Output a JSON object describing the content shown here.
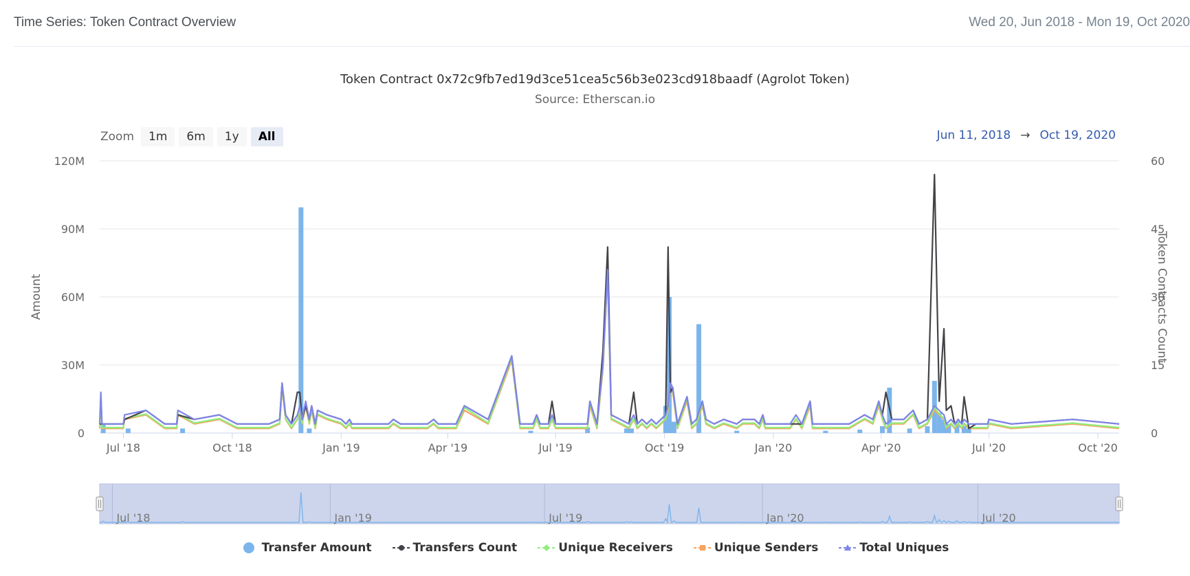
{
  "header": {
    "title": "Time Series: Token Contract Overview",
    "date_range": "Wed 20, Jun 2018 - Mon 19, Oct 2020"
  },
  "zoom": {
    "label": "Zoom",
    "buttons": [
      "1m",
      "6m",
      "1y",
      "All"
    ],
    "active": "All"
  },
  "range": {
    "from": "Jun 11, 2018",
    "arrow": "→",
    "to": "Oct 19, 2020"
  },
  "colors": {
    "transfer_amount": "#7cb5ec",
    "transfers_count": "#434348",
    "unique_receivers": "#90ed7d",
    "unique_senders": "#f7a35c",
    "total_uniques": "#8085e9"
  },
  "chart_data": {
    "type": "bar+line",
    "title": "Token Contract 0x72c9fb7ed19d3ce51cea5c56b3e023cd918baadf (Agrolot Token)",
    "subtitle": "Source: Etherscan.io",
    "ylabel_left": "Amount",
    "ylabel_right": "Token Contracts Count",
    "ylim_left": [
      0,
      120000000
    ],
    "ylim_right": [
      0,
      60
    ],
    "yticks_left": [
      "0",
      "30M",
      "60M",
      "90M",
      "120M"
    ],
    "yticks_right": [
      "0",
      "15",
      "30",
      "45",
      "60"
    ],
    "xlim": [
      "2018-06-11",
      "2020-10-19"
    ],
    "xticks": [
      {
        "date": "2018-07-01",
        "label": "Jul '18"
      },
      {
        "date": "2018-10-01",
        "label": "Oct '18"
      },
      {
        "date": "2019-01-01",
        "label": "Jan '19"
      },
      {
        "date": "2019-04-01",
        "label": "Apr '19"
      },
      {
        "date": "2019-07-01",
        "label": "Jul '19"
      },
      {
        "date": "2019-10-01",
        "label": "Oct '19"
      },
      {
        "date": "2020-01-01",
        "label": "Jan '20"
      },
      {
        "date": "2020-04-01",
        "label": "Apr '20"
      },
      {
        "date": "2020-07-01",
        "label": "Jul '20"
      },
      {
        "date": "2020-10-01",
        "label": "Oct '20"
      }
    ],
    "navigator_ticks": [
      {
        "date": "2018-07-01",
        "label": "Jul '18"
      },
      {
        "date": "2019-01-01",
        "label": "Jan '19"
      },
      {
        "date": "2019-07-01",
        "label": "Jul '19"
      },
      {
        "date": "2020-01-01",
        "label": "Jan '20"
      },
      {
        "date": "2020-07-01",
        "label": "Jul '20"
      }
    ],
    "legend": [
      "Transfer Amount",
      "Transfers Count",
      "Unique Receivers",
      "Unique Senders",
      "Total Uniques"
    ],
    "transfer_amount": {
      "name": "Transfer Amount",
      "axis": "left",
      "points": [
        [
          "2018-06-14",
          4000000
        ],
        [
          "2018-07-05",
          2000000
        ],
        [
          "2018-08-20",
          2000000
        ],
        [
          "2018-11-28",
          99500000
        ],
        [
          "2018-12-05",
          2000000
        ],
        [
          "2019-06-10",
          1000000
        ],
        [
          "2019-07-28",
          2500000
        ],
        [
          "2019-08-30",
          2000000
        ],
        [
          "2019-09-03",
          2000000
        ],
        [
          "2019-10-02",
          12000000
        ],
        [
          "2019-10-05",
          60000000
        ],
        [
          "2019-10-09",
          5000000
        ],
        [
          "2019-10-30",
          48000000
        ],
        [
          "2019-12-01",
          1000000
        ],
        [
          "2020-02-14",
          1000000
        ],
        [
          "2020-03-14",
          1500000
        ],
        [
          "2020-04-02",
          3000000
        ],
        [
          "2020-04-08",
          20000000
        ],
        [
          "2020-04-25",
          2000000
        ],
        [
          "2020-05-10",
          3000000
        ],
        [
          "2020-05-16",
          23000000
        ],
        [
          "2020-05-20",
          9000000
        ],
        [
          "2020-05-24",
          6000000
        ],
        [
          "2020-05-28",
          4000000
        ],
        [
          "2020-06-04",
          5000000
        ],
        [
          "2020-06-10",
          3000000
        ],
        [
          "2020-06-14",
          2000000
        ]
      ]
    },
    "total_uniques": {
      "name": "Total Uniques",
      "axis": "right",
      "points": [
        [
          "2018-06-11",
          2
        ],
        [
          "2018-06-12",
          9
        ],
        [
          "2018-06-13",
          2
        ],
        [
          "2018-07-01",
          2
        ],
        [
          "2018-07-02",
          4
        ],
        [
          "2018-07-20",
          5
        ],
        [
          "2018-08-05",
          2
        ],
        [
          "2018-08-15",
          2
        ],
        [
          "2018-08-16",
          5
        ],
        [
          "2018-08-30",
          3
        ],
        [
          "2018-09-20",
          4
        ],
        [
          "2018-10-05",
          2
        ],
        [
          "2018-11-01",
          2
        ],
        [
          "2018-11-10",
          3
        ],
        [
          "2018-11-12",
          11
        ],
        [
          "2018-11-15",
          4
        ],
        [
          "2018-11-20",
          2
        ],
        [
          "2018-11-25",
          4
        ],
        [
          "2018-11-27",
          6
        ],
        [
          "2018-11-29",
          3
        ],
        [
          "2018-12-02",
          7
        ],
        [
          "2018-12-05",
          3
        ],
        [
          "2018-12-07",
          6
        ],
        [
          "2018-12-10",
          2
        ],
        [
          "2018-12-12",
          5
        ],
        [
          "2018-12-20",
          4
        ],
        [
          "2019-01-01",
          3
        ],
        [
          "2019-01-05",
          2
        ],
        [
          "2019-01-08",
          3
        ],
        [
          "2019-01-10",
          2
        ],
        [
          "2019-02-10",
          2
        ],
        [
          "2019-02-14",
          3
        ],
        [
          "2019-02-20",
          2
        ],
        [
          "2019-03-15",
          2
        ],
        [
          "2019-03-20",
          3
        ],
        [
          "2019-03-24",
          2
        ],
        [
          "2019-04-08",
          2
        ],
        [
          "2019-04-15",
          6
        ],
        [
          "2019-05-05",
          3
        ],
        [
          "2019-05-25",
          17
        ],
        [
          "2019-06-01",
          2
        ],
        [
          "2019-06-12",
          2
        ],
        [
          "2019-06-15",
          4
        ],
        [
          "2019-06-18",
          2
        ],
        [
          "2019-06-25",
          2
        ],
        [
          "2019-06-28",
          4
        ],
        [
          "2019-07-01",
          2
        ],
        [
          "2019-07-20",
          2
        ],
        [
          "2019-07-28",
          2
        ],
        [
          "2019-07-30",
          7
        ],
        [
          "2019-08-05",
          2
        ],
        [
          "2019-08-10",
          15
        ],
        [
          "2019-08-14",
          36
        ],
        [
          "2019-08-17",
          4
        ],
        [
          "2019-09-01",
          2
        ],
        [
          "2019-09-05",
          4
        ],
        [
          "2019-09-08",
          2
        ],
        [
          "2019-09-12",
          3
        ],
        [
          "2019-09-16",
          2
        ],
        [
          "2019-09-20",
          3
        ],
        [
          "2019-09-24",
          2
        ],
        [
          "2019-09-28",
          3
        ],
        [
          "2019-10-02",
          4
        ],
        [
          "2019-10-04",
          6
        ],
        [
          "2019-10-06",
          11
        ],
        [
          "2019-10-08",
          10
        ],
        [
          "2019-10-12",
          2
        ],
        [
          "2019-10-20",
          8
        ],
        [
          "2019-10-24",
          2
        ],
        [
          "2019-10-28",
          3
        ],
        [
          "2019-11-02",
          7
        ],
        [
          "2019-11-05",
          3
        ],
        [
          "2019-11-12",
          2
        ],
        [
          "2019-11-20",
          3
        ],
        [
          "2019-12-01",
          2
        ],
        [
          "2019-12-06",
          3
        ],
        [
          "2019-12-16",
          3
        ],
        [
          "2019-12-20",
          2
        ],
        [
          "2019-12-23",
          4
        ],
        [
          "2019-12-25",
          2
        ],
        [
          "2020-01-15",
          2
        ],
        [
          "2020-01-20",
          4
        ],
        [
          "2020-01-25",
          2
        ],
        [
          "2020-02-01",
          7
        ],
        [
          "2020-02-03",
          2
        ],
        [
          "2020-03-05",
          2
        ],
        [
          "2020-03-18",
          4
        ],
        [
          "2020-03-25",
          3
        ],
        [
          "2020-03-30",
          7
        ],
        [
          "2020-04-02",
          4
        ],
        [
          "2020-04-05",
          2
        ],
        [
          "2020-04-10",
          3
        ],
        [
          "2020-04-20",
          3
        ],
        [
          "2020-04-28",
          5
        ],
        [
          "2020-05-03",
          2
        ],
        [
          "2020-05-10",
          3
        ],
        [
          "2020-05-16",
          6
        ],
        [
          "2020-05-20",
          5
        ],
        [
          "2020-05-24",
          4
        ],
        [
          "2020-05-26",
          2
        ],
        [
          "2020-05-30",
          3
        ],
        [
          "2020-06-02",
          2
        ],
        [
          "2020-06-05",
          3
        ],
        [
          "2020-06-08",
          2
        ],
        [
          "2020-06-10",
          3
        ],
        [
          "2020-06-14",
          2
        ],
        [
          "2020-06-20",
          2
        ],
        [
          "2020-06-30",
          2
        ],
        [
          "2020-07-01",
          3
        ],
        [
          "2020-07-20",
          2
        ],
        [
          "2020-09-10",
          3
        ],
        [
          "2020-10-19",
          2
        ]
      ]
    },
    "transfers_count": {
      "name": "Transfers Count",
      "axis": "right",
      "note": "Follows Total Uniques except at the peaks below",
      "overrides": [
        [
          "2018-06-12",
          2
        ],
        [
          "2018-07-02",
          3
        ],
        [
          "2018-08-16",
          4
        ],
        [
          "2018-11-25",
          9
        ],
        [
          "2018-11-27",
          9
        ],
        [
          "2018-12-02",
          6
        ],
        [
          "2019-04-15",
          6
        ],
        [
          "2019-06-28",
          7
        ],
        [
          "2019-08-10",
          18
        ],
        [
          "2019-08-14",
          41
        ],
        [
          "2019-09-05",
          9
        ],
        [
          "2019-10-04",
          41
        ],
        [
          "2019-10-06",
          9
        ],
        [
          "2020-01-20",
          2
        ],
        [
          "2020-04-05",
          9
        ],
        [
          "2020-05-16",
          57
        ],
        [
          "2020-05-20",
          7
        ],
        [
          "2020-05-24",
          23
        ],
        [
          "2020-05-26",
          5
        ],
        [
          "2020-05-30",
          6
        ],
        [
          "2020-06-10",
          8
        ],
        [
          "2020-06-14",
          1
        ]
      ]
    },
    "unique_receivers": {
      "name": "Unique Receivers",
      "axis": "right",
      "note": "Roughly Total Uniques minus 1",
      "offset": -1
    },
    "unique_senders": {
      "name": "Unique Senders",
      "axis": "right",
      "note": "Roughly Total Uniques minus 1",
      "offset": -1
    }
  }
}
